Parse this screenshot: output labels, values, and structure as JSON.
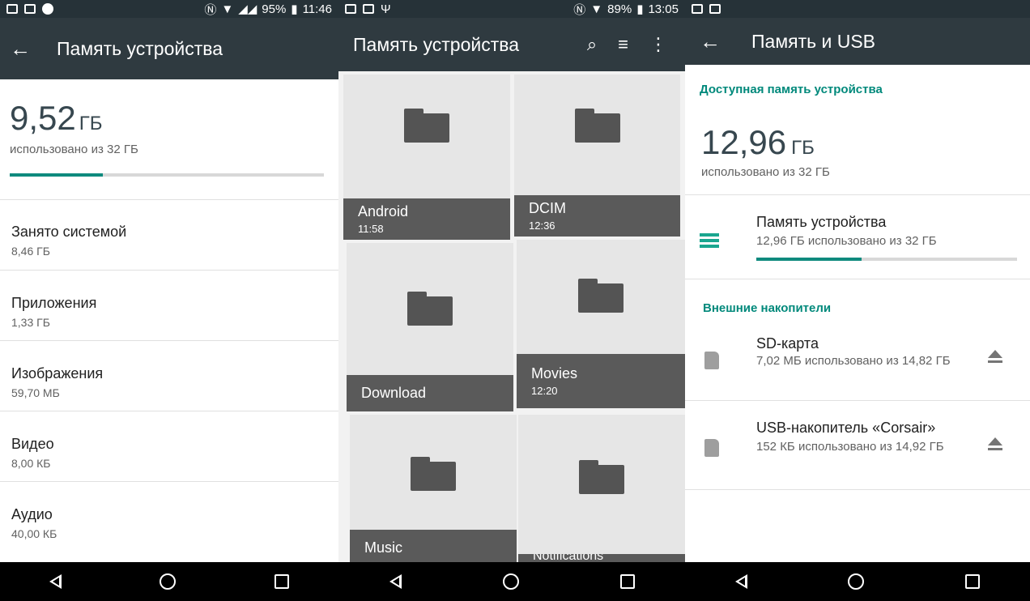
{
  "panel1": {
    "status": {
      "battery": "95%",
      "time": "11:46"
    },
    "title": "Память устройства",
    "total": {
      "value": "9,52",
      "unit": "ГБ",
      "subtitle": "использовано из 32 ГБ",
      "fraction": 0.2975
    },
    "rows": [
      {
        "label": "Занято системой",
        "value": "8,46 ГБ"
      },
      {
        "label": "Приложения",
        "value": "1,33 ГБ"
      },
      {
        "label": "Изображения",
        "value": "59,70 МБ"
      },
      {
        "label": "Видео",
        "value": "8,00 КБ"
      },
      {
        "label": "Аудио",
        "value": "40,00 КБ"
      }
    ]
  },
  "panel2": {
    "status": {
      "battery": "89%",
      "time": "13:05"
    },
    "title": "Память устройства",
    "folders": [
      {
        "name": "Android",
        "time": "11:58"
      },
      {
        "name": "DCIM",
        "time": "12:36"
      },
      {
        "name": "Download",
        "time": ""
      },
      {
        "name": "Movies",
        "time": "12:20"
      },
      {
        "name": "Music",
        "time": ""
      },
      {
        "name": "Notifications",
        "time": ""
      }
    ]
  },
  "panel3": {
    "title": "Память и USB",
    "internal_header": "Доступная память устройства",
    "total": {
      "value": "12,96",
      "unit": "ГБ",
      "subtitle": "использовано из 32 ГБ"
    },
    "device": {
      "title": "Память устройства",
      "summary": "12,96 ГБ использовано из 32 ГБ",
      "fraction": 0.405
    },
    "external_header": "Внешние накопители",
    "volumes": [
      {
        "title": "SD-карта",
        "summary": "7,02 МБ использовано из 14,82 ГБ"
      },
      {
        "title": "USB-накопитель «Corsair»",
        "summary": "152 КБ использовано из 14,92 ГБ"
      }
    ]
  },
  "icons": {
    "back": "←",
    "search": "⌕",
    "sort": "≡",
    "more": "⋮"
  },
  "colors": {
    "accent": "#0f8a7e",
    "appbar": "#2f3a40",
    "status": "#263238"
  }
}
